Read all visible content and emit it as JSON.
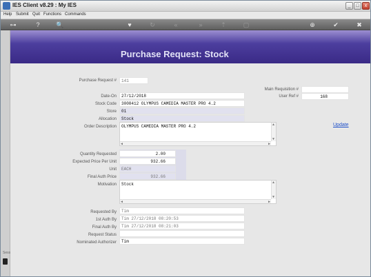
{
  "window": {
    "title": "IES Client v8.29 : My IES",
    "minimize": "_",
    "maximize": "□",
    "close": "x"
  },
  "menu": [
    "Help",
    "Submit",
    "Quit",
    "Functions",
    "Commands"
  ],
  "toolbar": {
    "icons": [
      "key-icon",
      "help-icon",
      "search-icon",
      "heart-icon",
      "refresh-icon",
      "back-icon",
      "forward-icon",
      "upload-icon",
      "stop-icon",
      "add-icon",
      "ok-icon",
      "close-icon"
    ],
    "glyphs": [
      "⊶",
      "?",
      "🔍",
      "♥",
      "↻",
      "«",
      "»",
      "⇡",
      "▢",
      "⊕",
      "✔",
      "✖"
    ]
  },
  "page": {
    "title": "Purchase Request: Stock"
  },
  "form": {
    "purchase_request_label": "Purchase Request #",
    "purchase_request_value": "141",
    "main_requisition_label": "Main Requisition #",
    "main_requisition_value": "",
    "user_ref_label": "User Ref #",
    "user_ref_value": "168",
    "date_on_label": "Date-On",
    "date_on_value": "27/12/2018",
    "stock_code_label": "Stock Code",
    "stock_code_value": "3008412 OLYMPUS CAMEDIA MASTER PRO 4.2",
    "store_label": "Store",
    "store_value": "01",
    "allocation_label": "Allocation",
    "allocation_value": "Stock",
    "order_description_label": "Order Description",
    "order_description_value": "OLYMPUS CAMEDIA MASTER PRO 4.2",
    "update_link": "Update",
    "quantity_label": "Quantity Requested",
    "quantity_value": "2.00",
    "expected_price_label": "Expected Price Per Unit",
    "expected_price_value": "932.66",
    "unit_label": "Unit",
    "unit_value": "EACH",
    "final_auth_price_label": "Final Auth Price",
    "final_auth_price_value": "932.66",
    "motivation_label": "Motivation",
    "motivation_value": "Stock",
    "requested_by_label": "Requested By",
    "requested_by_value": "Tim",
    "first_auth_label": "1st Auth By",
    "first_auth_value": "Tim 27/12/2018 08:20:53",
    "final_auth_label": "Final Auth By",
    "final_auth_value": "Tim 27/12/2018 08:21:03",
    "request_status_label": "Request Status",
    "request_status_value": "",
    "nominated_label": "Nominated Authorizer",
    "nominated_value": "Tim"
  },
  "left_strip": {
    "label": "Sess"
  }
}
